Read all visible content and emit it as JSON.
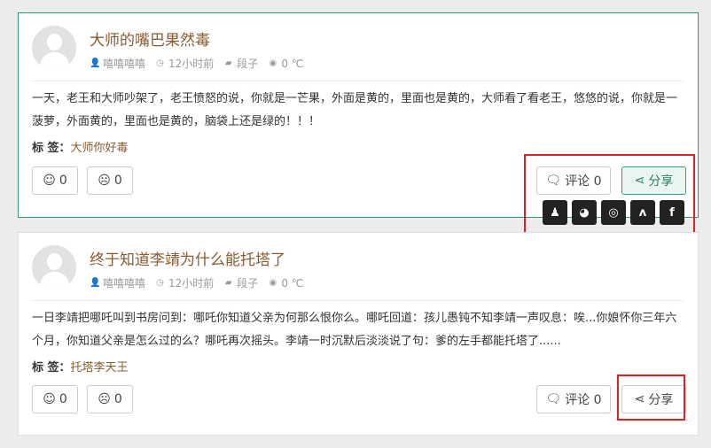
{
  "posts": [
    {
      "title": "大师的嘴巴果然毒",
      "author": "嘻嘻嘻嘻",
      "time": "12小时前",
      "category": "段子",
      "temp": "0 ℃",
      "content": "一天，老王和大师吵架了，老王愤怒的说，你就是一芒果，外面是黄的，里面也是黄的，大师看了看老王，悠悠的说，你就是一菠萝，外面黄的，里面也是黄的，脑袋上还是绿的！！！",
      "tags_label": "标 签：",
      "tag": "大师你好毒",
      "like": "0",
      "dislike": "0",
      "comment": "评论 0",
      "share": "分享"
    },
    {
      "title": "终于知道李靖为什么能托塔了",
      "author": "嘻嘻嘻嘻",
      "time": "12小时前",
      "category": "段子",
      "temp": "0 ℃",
      "content": "一日李靖把哪吒叫到书房问到：哪吒你知道父亲为何那么恨你么。哪吒回道：孩儿愚钝不知李靖一声叹息：唉...你娘怀你三年六个月，你知道父亲是怎么过的么？哪吒再次摇头。李靖一时沉默后淡淡说了句：爹的左手都能托塔了......",
      "tags_label": "标 签：",
      "tag": "托塔李天王",
      "like": "0",
      "dislike": "0",
      "comment": "评论 0",
      "share": "分享"
    }
  ],
  "share_icons": [
    "qq-icon",
    "wechat-icon",
    "weibo-icon",
    "renren-icon",
    "facebook-icon"
  ],
  "colors": {
    "accent": "#2f9c7a",
    "title": "#8a5b2e",
    "highlight": "#e02020"
  }
}
